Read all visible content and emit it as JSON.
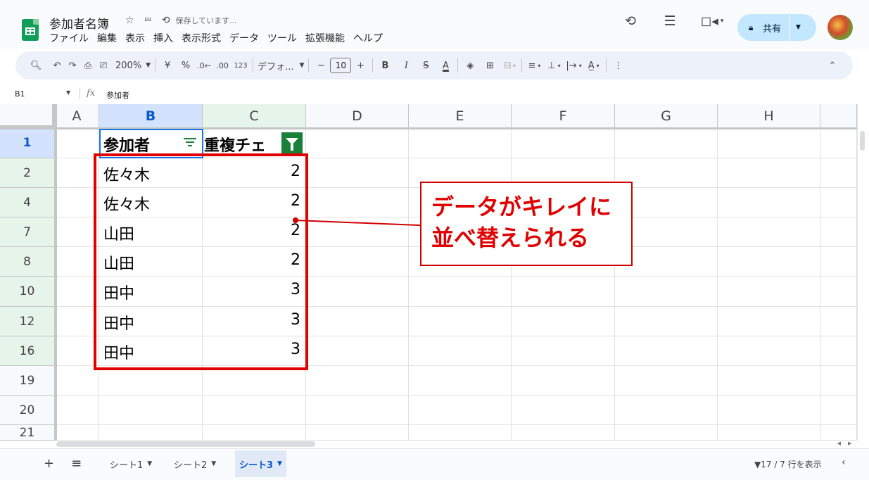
{
  "app": {
    "doc_title": "参加者名簿",
    "save_status": "保存しています...",
    "menu": [
      "ファイル",
      "編集",
      "表示",
      "挿入",
      "表示形式",
      "データ",
      "ツール",
      "拡張機能",
      "ヘルプ"
    ],
    "share_label": "共有",
    "accent_color": "#c2e7ff",
    "icons": {
      "star": "star-icon",
      "move": "move-to-folder-icon",
      "status": "cloud-saving-icon",
      "history": "history-icon",
      "comments": "comments-icon",
      "meet": "video-call-icon",
      "lock": "lock-icon"
    }
  },
  "toolbar": {
    "zoom": "200%",
    "currency": "¥",
    "percent": "%",
    "dec_decrease": ".0←",
    "dec_increase": ".00",
    "format_123": "123",
    "font": "デフォ...",
    "font_size": "10",
    "minus": "−",
    "plus": "+",
    "bold": "B",
    "italic": "I",
    "strike": "S",
    "textcolor": "A"
  },
  "formula_bar": {
    "name_box": "B1",
    "fx": "fx",
    "content": "参加者"
  },
  "columns": [
    "A",
    "B",
    "C",
    "D",
    "E",
    "F",
    "G",
    "H"
  ],
  "rows": [
    {
      "num": "1",
      "b": "参加者",
      "c": "重複チェ"
    },
    {
      "num": "2",
      "b": "佐々木",
      "c": "2"
    },
    {
      "num": "4",
      "b": "佐々木",
      "c": "2"
    },
    {
      "num": "7",
      "b": "山田",
      "c": "2"
    },
    {
      "num": "8",
      "b": "山田",
      "c": "2"
    },
    {
      "num": "10",
      "b": "田中",
      "c": "3"
    },
    {
      "num": "12",
      "b": "田中",
      "c": "3"
    },
    {
      "num": "16",
      "b": "田中",
      "c": "3"
    },
    {
      "num": "19",
      "b": "",
      "c": ""
    },
    {
      "num": "20",
      "b": "",
      "c": ""
    },
    {
      "num": "21",
      "b": "",
      "c": ""
    }
  ],
  "annotation": {
    "text": "データがキレイに\n並べ替えられる",
    "color": "#e00000"
  },
  "sheets": [
    {
      "label": "シート1",
      "active": false
    },
    {
      "label": "シート2",
      "active": false
    },
    {
      "label": "シート3",
      "active": true
    }
  ],
  "status": {
    "row_count": "17 / 7 行を表示"
  }
}
